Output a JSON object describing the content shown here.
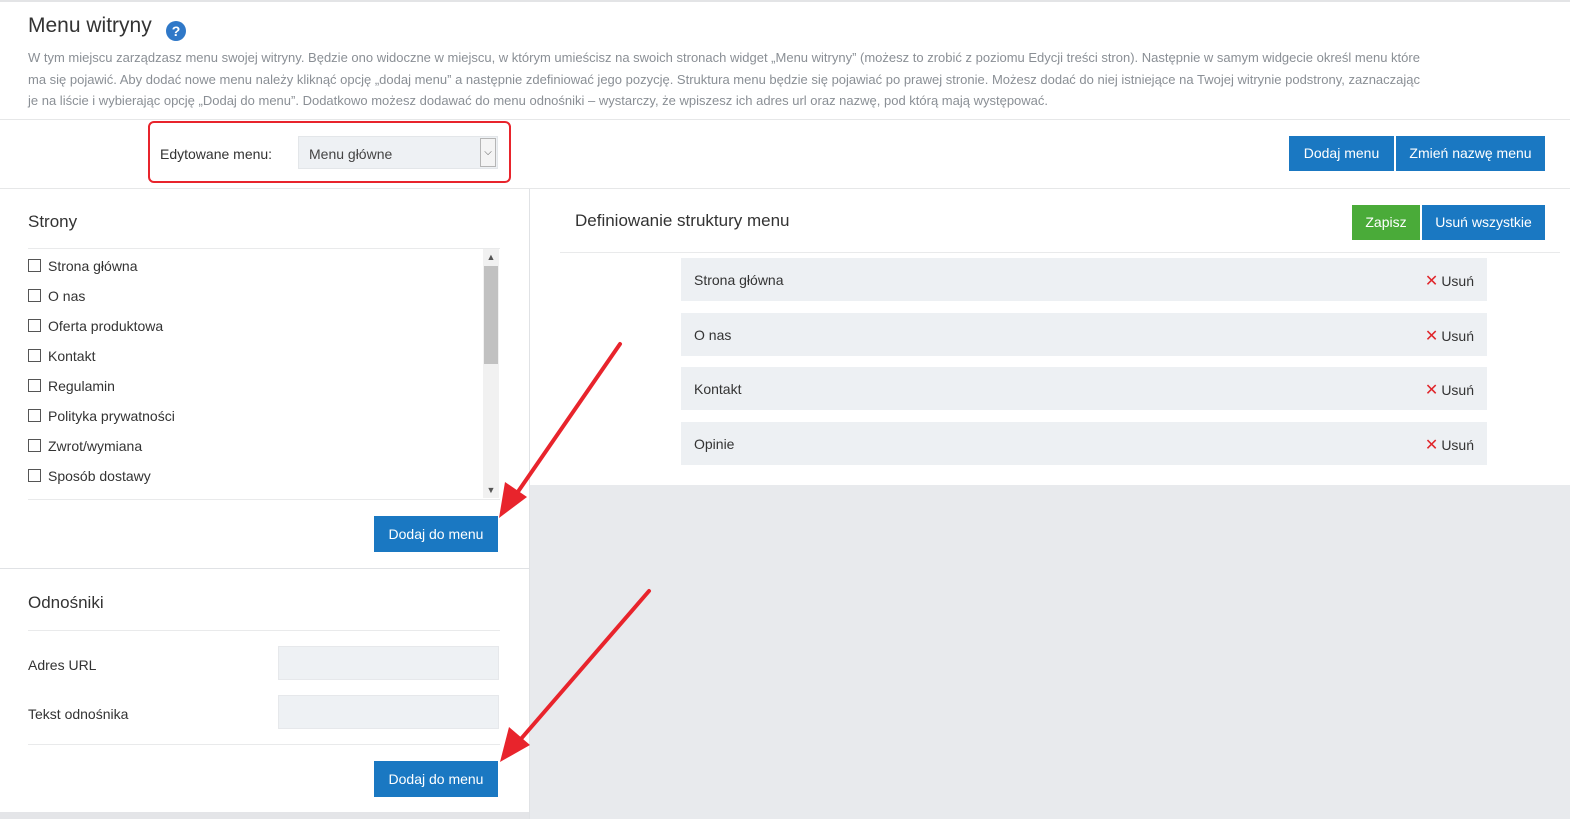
{
  "header": {
    "title": "Menu witryny",
    "help_icon": "?",
    "description": "W tym miejscu zarządzasz menu swojej witryny. Będzie ono widoczne w miejscu, w którym umieścisz na swoich stronach widget „Menu witryny” (możesz to zrobić z poziomu Edycji treści stron). Następnie w samym widgecie określ menu które ma się pojawić. Aby dodać nowe menu należy kliknąć opcję „dodaj menu” a następnie zdefiniować jego pozycję. Struktura menu będzie się pojawiać po prawej stronie. Możesz dodać do niej istniejące na Twojej witrynie podstrony, zaznaczając je na liście i wybierając opcję „Dodaj do menu”. Dodatkowo możesz dodawać do menu odnośniki – wystarczy, że wpiszesz ich adres url oraz nazwę, pod którą mają występować."
  },
  "menu_selector": {
    "label": "Edytowane menu:",
    "selected": "Menu główne",
    "add_menu": "Dodaj menu",
    "rename_menu": "Zmień nazwę menu"
  },
  "pages": {
    "title": "Strony",
    "items": [
      {
        "label": "Strona główna",
        "checked": false
      },
      {
        "label": "O nas",
        "checked": false
      },
      {
        "label": "Oferta produktowa",
        "checked": false
      },
      {
        "label": "Kontakt",
        "checked": false
      },
      {
        "label": "Regulamin",
        "checked": false
      },
      {
        "label": "Polityka prywatności",
        "checked": false
      },
      {
        "label": "Zwrot/wymiana",
        "checked": false
      },
      {
        "label": "Sposób dostawy",
        "checked": false
      }
    ],
    "add_button": "Dodaj do menu"
  },
  "links": {
    "title": "Odnośniki",
    "url_label": "Adres URL",
    "url_value": "",
    "text_label": "Tekst odnośnika",
    "text_value": "",
    "add_button": "Dodaj do menu"
  },
  "structure": {
    "title": "Definiowanie struktury menu",
    "save": "Zapisz",
    "remove_all": "Usuń wszystkie",
    "items": [
      {
        "label": "Strona główna",
        "remove": "Usuń"
      },
      {
        "label": "O nas",
        "remove": "Usuń"
      },
      {
        "label": "Kontakt",
        "remove": "Usuń"
      },
      {
        "label": "Opinie",
        "remove": "Usuń"
      }
    ]
  },
  "colors": {
    "primary_button": "#1a78c2",
    "save_button": "#4aab39",
    "remove_x": "#e0262b",
    "annotation_red": "#e8242c"
  }
}
